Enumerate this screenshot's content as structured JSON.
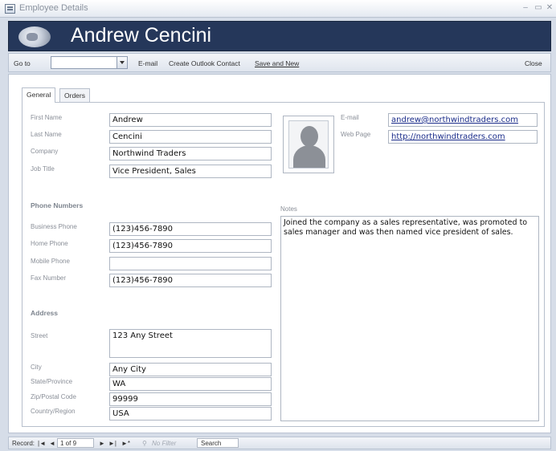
{
  "window": {
    "title": "Employee Details",
    "minimize": "–",
    "maximize": "▭",
    "close": "✕"
  },
  "header": {
    "employee_name": "Andrew Cencini"
  },
  "toolbar": {
    "goto_label": "Go to",
    "goto_value": "",
    "email_label": "E-mail",
    "outlook_label": "Create Outlook Contact",
    "save_new_label": "Save and New",
    "close_label": "Close"
  },
  "tabs": [
    {
      "label": "General",
      "active": true
    },
    {
      "label": "Orders",
      "active": false
    }
  ],
  "general": {
    "first_name": {
      "label": "First Name",
      "value": "Andrew"
    },
    "last_name": {
      "label": "Last Name",
      "value": "Cencini"
    },
    "company": {
      "label": "Company",
      "value": "Northwind Traders"
    },
    "job_title": {
      "label": "Job Title",
      "value": "Vice President, Sales"
    },
    "email": {
      "label": "E-mail",
      "value": "andrew@northwindtraders.com"
    },
    "web_page": {
      "label": "Web Page",
      "value": "http://northwindtraders.com"
    }
  },
  "phone": {
    "section_title": "Phone Numbers",
    "business": {
      "label": "Business Phone",
      "value": "(123)456-7890"
    },
    "home": {
      "label": "Home Phone",
      "value": "(123)456-7890"
    },
    "mobile": {
      "label": "Mobile Phone",
      "value": ""
    },
    "fax": {
      "label": "Fax Number",
      "value": "(123)456-7890"
    }
  },
  "address": {
    "section_title": "Address",
    "street": {
      "label": "Street",
      "value": "123 Any Street"
    },
    "city": {
      "label": "City",
      "value": "Any City"
    },
    "state": {
      "label": "State/Province",
      "value": "WA"
    },
    "zip": {
      "label": "Zip/Postal Code",
      "value": "99999"
    },
    "country": {
      "label": "Country/Region",
      "value": "USA"
    }
  },
  "notes": {
    "label": "Notes",
    "value": "Joined the company as a sales representative, was promoted to sales manager and was then named vice president of sales."
  },
  "status_bar": {
    "record_label": "Record:",
    "first": "|◄",
    "prev": "◄",
    "position": "1 of 9",
    "next": "►",
    "last": "►|",
    "new": "►*",
    "filter_label": "No Filter",
    "search_label": "Search"
  },
  "colors": {
    "header_bg": "#25375a",
    "link": "#1a2c8a"
  },
  "icons": [
    "form-icon",
    "employee-logo-icon",
    "dropdown-arrow-icon",
    "photo-placeholder-icon",
    "filter-icon"
  ]
}
